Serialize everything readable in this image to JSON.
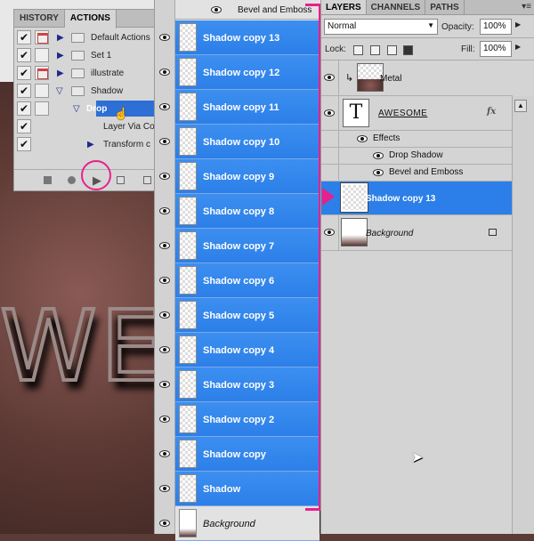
{
  "actions_panel": {
    "tabs": [
      "HISTORY",
      "ACTIONS"
    ],
    "rows": [
      {
        "label": "Default Actions",
        "type": "folder"
      },
      {
        "label": "Set 1",
        "type": "folder"
      },
      {
        "label": "illustrate",
        "type": "folder"
      },
      {
        "label": "Shadow",
        "type": "folder"
      },
      {
        "label": "Drop",
        "type": "action"
      },
      {
        "label": "Layer Via Co",
        "type": "step"
      },
      {
        "label": "Transform c",
        "type": "step"
      }
    ]
  },
  "dragged_layers": {
    "top_effect": "Bevel and Emboss",
    "rows": [
      "Shadow copy 13",
      "Shadow copy 12",
      "Shadow copy 11",
      "Shadow copy 10",
      "Shadow copy 9",
      "Shadow copy 8",
      "Shadow copy 7",
      "Shadow copy 6",
      "Shadow copy 5",
      "Shadow copy 4",
      "Shadow copy 3",
      "Shadow copy 2",
      "Shadow copy",
      "Shadow"
    ],
    "background": "Background"
  },
  "layers_panel": {
    "tabs": [
      "LAYERS",
      "CHANNELS",
      "PATHS"
    ],
    "blend_mode": "Normal",
    "opacity_label": "Opacity:",
    "opacity_value": "100%",
    "lock_label": "Lock:",
    "fill_label": "Fill:",
    "fill_value": "100%",
    "layers": {
      "metal": "Metal",
      "awesome": "AWESOME",
      "effects": "Effects",
      "drop_shadow": "Drop Shadow",
      "bevel": "Bevel and Emboss",
      "shadow13": "Shadow copy 13",
      "background": "Background"
    },
    "fx": "fx"
  },
  "canvas": {
    "word": "WE"
  },
  "colors": {
    "selection": "#2c7fe8",
    "highlight": "#e8208c"
  }
}
